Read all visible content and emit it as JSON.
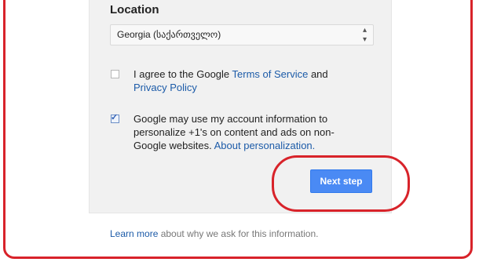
{
  "location": {
    "label": "Location",
    "selected": "Georgia (საქართველო)"
  },
  "terms": {
    "checked": false,
    "prefix": "I agree to the Google ",
    "terms_link": "Terms of Service",
    "and": " and",
    "privacy_link": "Privacy Policy"
  },
  "personalization": {
    "checked": true,
    "text": "Google may use my account information to personalize +1's on content and ads on non-Google websites. ",
    "link": "About personalization."
  },
  "next_button": {
    "label": "Next step",
    "color": "#4a8af4"
  },
  "footer": {
    "link": "Learn more",
    "text": " about why we ask for this information."
  },
  "colors": {
    "annotation": "#d8232a",
    "link": "#1c5ba8"
  }
}
